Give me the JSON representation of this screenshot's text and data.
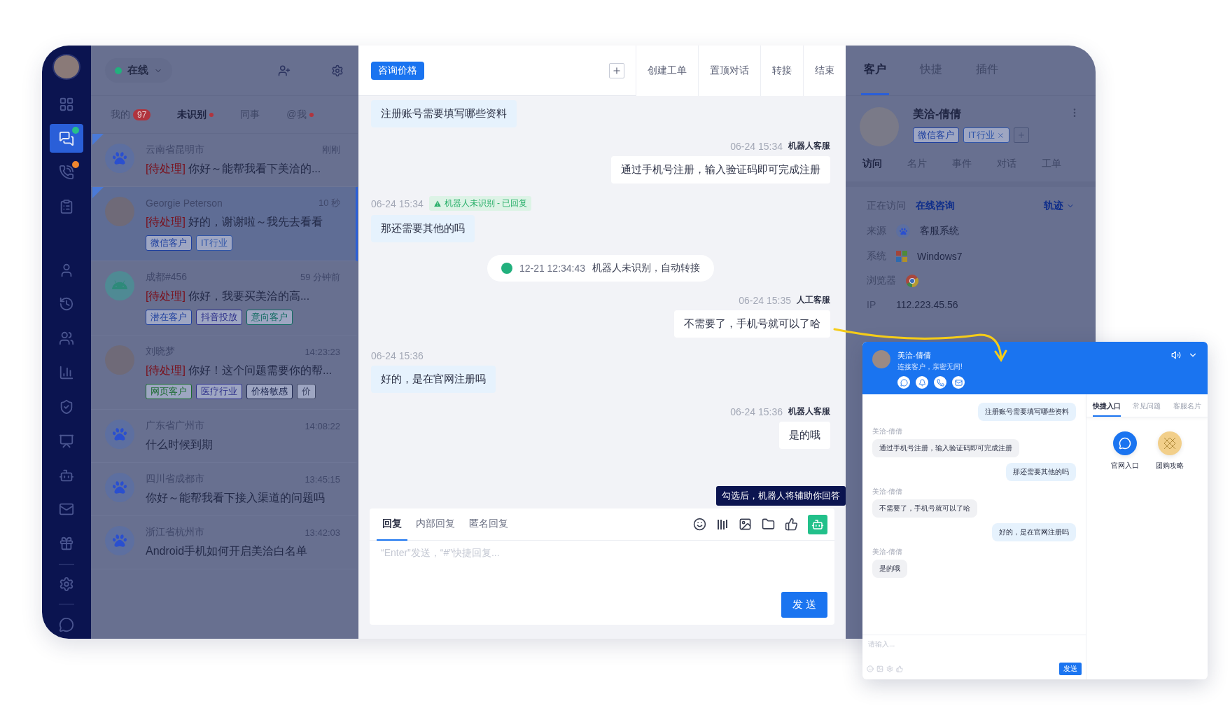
{
  "nav_items": [
    {
      "selected": false
    },
    {
      "selected": true,
      "color": "#27c08a"
    },
    {
      "selected": false,
      "color": "#f0862e"
    },
    {
      "selected": false
    },
    {
      "selected": false
    },
    {
      "selected": false
    },
    {
      "selected": false
    },
    {
      "selected": false
    },
    {
      "selected": false
    },
    {
      "selected": false
    },
    {
      "selected": false
    },
    {
      "selected": false
    },
    {
      "selected": false
    },
    {
      "selected": false
    },
    {
      "selected": false
    }
  ],
  "status": {
    "label": "在线",
    "color": "#22b07d"
  },
  "list_tabs": [
    {
      "label": "我的",
      "count": "97",
      "dot": false,
      "selected": false
    },
    {
      "label": "未识别",
      "dot": true,
      "selected": true
    },
    {
      "label": "同事",
      "dot": false,
      "selected": false
    },
    {
      "label": "@我",
      "dot": true,
      "selected": false
    }
  ],
  "conversations": [
    {
      "kind": "paw",
      "flagged": true,
      "selected": false,
      "name": "云南省昆明市",
      "time": "刚刚",
      "status": "[待处理]",
      "message": "你好～能帮我看下美洽的..."
    },
    {
      "kind": "photo",
      "flagged": true,
      "selected": true,
      "name": "Georgie Peterson",
      "time": "10 秒",
      "status": "[待处理]",
      "message": "好的，谢谢啦～我先去看看",
      "tags": [
        {
          "label": "微信客户",
          "color": "#1d3f9e"
        },
        {
          "label": "IT行业",
          "color": "#2f55a8"
        }
      ]
    },
    {
      "kind": "android",
      "flagged": false,
      "selected": false,
      "name": "成都#456",
      "time": "59 分钟前",
      "status": "[待处理]",
      "message": "你好，我要买美洽的高...",
      "tags": [
        {
          "label": "潜在客户",
          "color": "#1d3f9e"
        },
        {
          "label": "抖音投放",
          "color": "#2c2f8a"
        },
        {
          "label": "意向客户",
          "color": "#0f6a60"
        }
      ]
    },
    {
      "kind": "photo",
      "flagged": false,
      "selected": false,
      "name": "刘晓梦",
      "time": "14:23:23",
      "status": "[待处理]",
      "message": "你好！这个问题需要你的帮...",
      "tags": [
        {
          "label": "网页客户",
          "color": "#1a6a30"
        },
        {
          "label": "医疗行业",
          "color": "#2c2f8a"
        },
        {
          "label": "价格敏感",
          "color": "#1e2850"
        },
        {
          "label": "价",
          "color": "#3f4766"
        }
      ]
    },
    {
      "kind": "paw",
      "flagged": false,
      "selected": false,
      "name": "广东省广州市",
      "time": "14:08:22",
      "message": "什么时候到期"
    },
    {
      "kind": "paw",
      "flagged": false,
      "selected": false,
      "name": "四川省成都市",
      "time": "13:45:15",
      "message": "你好～能帮我看下接入渠道的问题吗"
    },
    {
      "kind": "paw",
      "flagged": false,
      "selected": false,
      "name": "浙江省杭州市",
      "time": "13:42:03",
      "message": "Android手机如何开启美洽白名单"
    }
  ],
  "chat_header": {
    "topic": "咨询价格",
    "actions": [
      "创建工单",
      "置顶对话",
      "转接",
      "结束"
    ]
  },
  "messages": [
    {
      "kind": "customer",
      "text": "注册账号需要填写哪些资料"
    },
    {
      "kind": "agent",
      "time": "06-24 15:34",
      "sender": "机器人客服",
      "text": "通过手机号注册，输入验证码即可完成注册"
    },
    {
      "kind": "customer",
      "time": "06-24 15:34",
      "notice": "机器人未识别 - 已回复",
      "text": "那还需要其他的吗"
    },
    {
      "kind": "system",
      "time": "12-21 12:34:43",
      "text": "机器人未识别，自动转接"
    },
    {
      "kind": "agent",
      "time": "06-24 15:35",
      "sender": "人工客服",
      "text": "不需要了，手机号就可以了哈"
    },
    {
      "kind": "customer",
      "time": "06-24 15:36",
      "text": "好的，是在官网注册吗"
    },
    {
      "kind": "agent",
      "time": "06-24 15:36",
      "sender": "机器人客服",
      "text": "是的哦"
    }
  ],
  "composer": {
    "tabs": [
      {
        "label": "回复",
        "selected": true
      },
      {
        "label": "内部回复",
        "selected": false
      },
      {
        "label": "匿名回复",
        "selected": false
      }
    ],
    "assist_on": true,
    "tooltip": "勾选后，机器人将辅助你回答",
    "placeholder": "“Enter”发送，“#”快捷回复...",
    "send": "发 送"
  },
  "customer_panel": {
    "tabs": [
      {
        "label": "客户",
        "selected": true
      },
      {
        "label": "快捷",
        "selected": false
      },
      {
        "label": "插件",
        "selected": false
      }
    ],
    "name": "美洽-倩倩",
    "tags": [
      {
        "label": "微信客户",
        "color": "#1d3f9e",
        "removable": false
      },
      {
        "label": "IT行业",
        "color": "#2f55a8",
        "removable": true
      }
    ],
    "subtabs": [
      {
        "label": "访问",
        "selected": true
      },
      {
        "label": "名片",
        "selected": false
      },
      {
        "label": "事件",
        "selected": false
      },
      {
        "label": "对话",
        "selected": false
      },
      {
        "label": "工单",
        "selected": false
      }
    ],
    "visiting": {
      "label": "正在访问",
      "value": "在线咨询",
      "trail": "轨迹"
    },
    "info": [
      {
        "kind": "source",
        "label": "来源",
        "value": "客服系统"
      },
      {
        "kind": "os",
        "label": "系统",
        "value": "Windows7"
      },
      {
        "kind": "browser",
        "label": "浏览器"
      },
      {
        "kind": "ip",
        "label": "IP",
        "value": "112.223.45.56"
      }
    ]
  },
  "widget": {
    "name": "美洽-倩倩",
    "subtitle": "连接客户，亲密无间!",
    "messages": [
      {
        "kind": "visitor",
        "text": "注册账号需要填写哪些资料"
      },
      {
        "kind": "agent",
        "sender": "美洽-倩倩",
        "text": "通过手机号注册，输入验证码即可完成注册"
      },
      {
        "kind": "visitor",
        "text": "那还需要其他的吗"
      },
      {
        "kind": "agent",
        "sender": "美洽-倩倩",
        "text": "不需要了，手机号就可以了哈"
      },
      {
        "kind": "visitor",
        "text": "好的，是在官网注册吗"
      },
      {
        "kind": "agent",
        "sender": "美洽-倩倩",
        "text": "是的哦"
      }
    ],
    "placeholder": "请输入...",
    "send": "发送",
    "tabs": [
      {
        "label": "快捷入口",
        "selected": true
      },
      {
        "label": "常见问题",
        "selected": false
      },
      {
        "label": "客服名片",
        "selected": false
      }
    ],
    "shortcuts": [
      {
        "kind": "site",
        "label": "官网入口"
      },
      {
        "kind": "deal",
        "label": "团购攻略"
      }
    ]
  }
}
